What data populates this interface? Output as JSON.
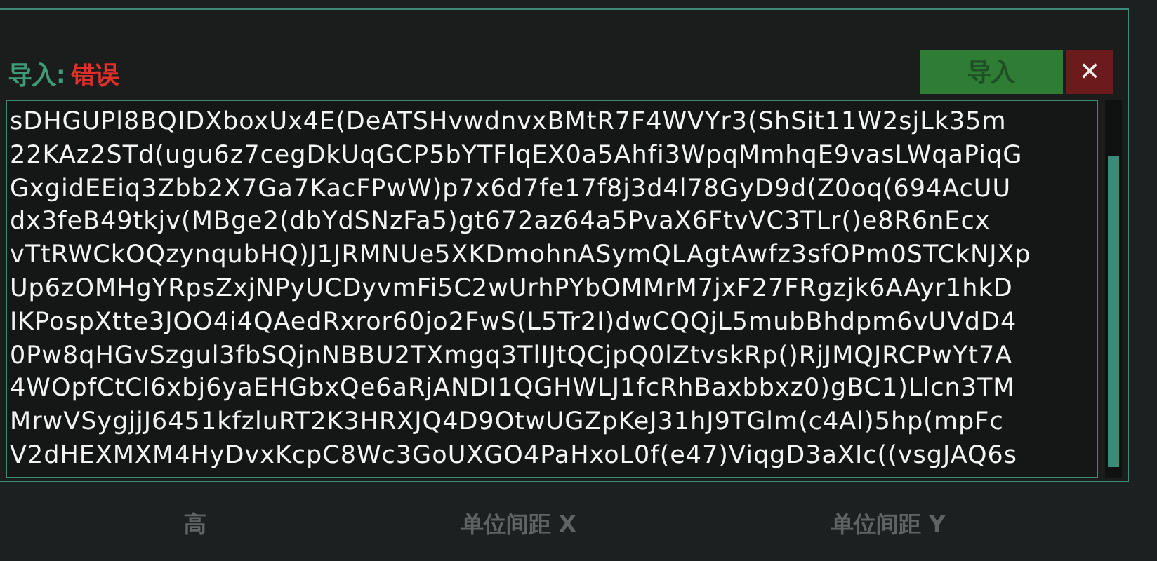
{
  "dialog": {
    "label": "导入:",
    "status": "错误",
    "import_button": "导入",
    "close_button": "✕",
    "text_lines": [
      "sDHGUPl8BQIDXboxUx4E(DeATSHvwdnvxBMtR7F4WVYr3(ShSit11W2sjLk35m",
      "22KAz2STd(ugu6z7cegDkUqGCP5bYTFlqEX0a5Ahfi3WpqMmhqE9vasLWqaPiqG",
      "GxgidEEiq3Zbb2X7Ga7KacFPwW)p7x6d7fe17f8j3d4l78GyD9d(Z0oq(694AcUU",
      "dx3feB49tkjv(MBge2(dbYdSNzFa5)gt672az64a5PvaX6FtvVC3TLr()e8R6nEcx",
      "vTtRWCkOQzynqubHQ)J1JRMNUe5XKDmohnASymQLAgtAwfz3sfOPm0STCkNJXp",
      "Up6zOMHgYRpsZxjNPyUCDyvmFi5C2wUrhPYbOMMrM7jxF27FRgzjk6AAyr1hkD",
      "IKPospXtte3JOO4i4QAedRxror60jo2FwS(L5Tr2I)dwCQQjL5mubBhdpm6vUVdD4",
      "0Pw8qHGvSzgul3fbSQjnNBBU2TXmgq3TlIJtQCjpQ0lZtvskRp()RjJMQJRCPwYt7A",
      "4WOpfCtCl6xbj6yaEHGbxQe6aRjANDI1QGHWLJ1fcRhBaxbbxz0)gBC1)Llcn3TM",
      "MrwVSygjjJ6451kfzluRT2K3HRXJQ4D9OtwUGZpKeJ31hJ9TGlm(c4Al)5hp(mpFc",
      "V2dHEXMXM4HyDvxKcpC8Wc3GoUXGO4PaHxoL0f(e47)ViqgD3aXIc((vsgJAQ6s"
    ]
  },
  "fields": [
    {
      "label": "高"
    },
    {
      "label": "单位间距 X"
    },
    {
      "label": "单位间距 Y"
    }
  ]
}
